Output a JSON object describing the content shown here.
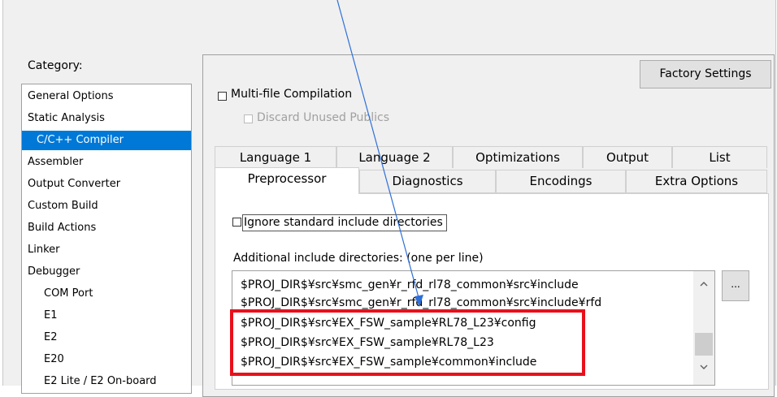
{
  "category": {
    "label": "Category:",
    "items": [
      {
        "label": "General Options"
      },
      {
        "label": "Static Analysis"
      },
      {
        "label": "C/C++ Compiler"
      },
      {
        "label": "Assembler"
      },
      {
        "label": "Output Converter"
      },
      {
        "label": "Custom Build"
      },
      {
        "label": "Build Actions"
      },
      {
        "label": "Linker"
      },
      {
        "label": "Debugger"
      },
      {
        "label": "COM Port"
      },
      {
        "label": "E1"
      },
      {
        "label": "E2"
      },
      {
        "label": "E20"
      },
      {
        "label": "E2 Lite / E2 On-board"
      }
    ],
    "selected": "C/C++ Compiler"
  },
  "factory_settings_label": "Factory Settings",
  "multi_file": {
    "label": "Multi-file Compilation",
    "checked": false
  },
  "discard_unused": {
    "label": "Discard Unused Publics",
    "checked": false,
    "enabled": false
  },
  "tabs_row1": [
    "Language 1",
    "Language 2",
    "Optimizations",
    "Output",
    "List"
  ],
  "tabs_row2": [
    "Preprocessor",
    "Diagnostics",
    "Encodings",
    "Extra Options"
  ],
  "active_tab": "Preprocessor",
  "ignore_std": {
    "label": "Ignore standard include directories",
    "checked": false
  },
  "include_dirs": {
    "label": "Additional include directories: (one per line)",
    "lines": [
      "$PROJ_DIR$¥src¥smc_gen¥r_rfd_rl78_common¥src¥include",
      "$PROJ_DIR$¥src¥smc_gen¥r_rfd_rl78_common¥src¥include¥rfd",
      "$PROJ_DIR$¥src¥EX_FSW_sample¥RL78_L23¥config",
      "$PROJ_DIR$¥src¥EX_FSW_sample¥RL78_L23",
      "$PROJ_DIR$¥src¥EX_FSW_sample¥common¥include"
    ],
    "browse_label": "..."
  },
  "colors": {
    "selection": "#0078d7",
    "highlight_box": "#e8101a",
    "arrow": "#2e6fd8"
  },
  "icons": {
    "scroll_up": "chevron-up-icon",
    "scroll_down": "chevron-down-icon"
  }
}
